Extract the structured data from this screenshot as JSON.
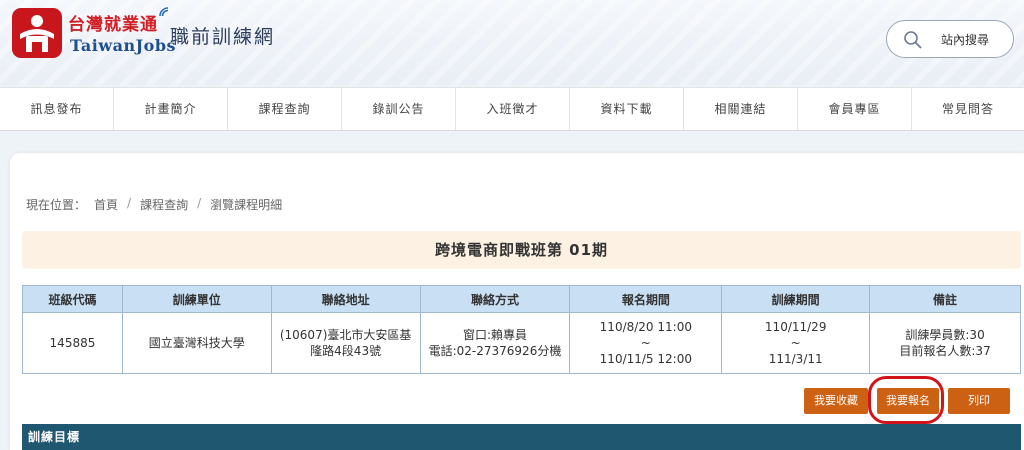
{
  "brand": {
    "name_zh": "台灣就業通",
    "name_en": "TaiwanJobs",
    "site_name": "職前訓練網"
  },
  "search": {
    "label": "站內搜尋"
  },
  "nav": [
    {
      "label": "訊息發布"
    },
    {
      "label": "計畫簡介"
    },
    {
      "label": "課程查詢"
    },
    {
      "label": "錄訓公告"
    },
    {
      "label": "入班徵才"
    },
    {
      "label": "資料下載"
    },
    {
      "label": "相關連結"
    },
    {
      "label": "會員專區"
    },
    {
      "label": "常見問答"
    }
  ],
  "breadcrumb": {
    "prefix": "現在位置：",
    "items": [
      "首頁",
      "課程查詢",
      "瀏覽課程明細"
    ]
  },
  "course_title": "跨境電商即戰班第 01期",
  "table": {
    "headers": [
      "班級代碼",
      "訓練單位",
      "聯絡地址",
      "聯絡方式",
      "報名期間",
      "訓練期間",
      "備註"
    ],
    "row": {
      "code": "145885",
      "unit": "國立臺灣科技大學",
      "address_1": "(10607)臺北市大安區基",
      "address_2": "隆路4段43號",
      "contact_1": "窗口:賴專員",
      "contact_2": "電話:02-27376926分機",
      "signup_start": "110/8/20 11:00",
      "signup_sep": "~",
      "signup_end": "110/11/5 12:00",
      "train_start": "110/11/29",
      "train_sep": "~",
      "train_end": "111/3/11",
      "note_1": "訓練學員數:30",
      "note_2": "目前報名人數:37"
    }
  },
  "buttons": {
    "favorite": "我要收藏",
    "signup": "我要報名",
    "print": "列印"
  },
  "section": {
    "title": "訓練目標"
  },
  "colors": {
    "brand_red": "#c8161d",
    "nav_text": "#444444",
    "button_orange": "#cc6113",
    "table_header": "#c9dff3",
    "section_bar": "#1f5670",
    "banner": "#fdf1e3",
    "highlight_ring": "#d0141c"
  }
}
